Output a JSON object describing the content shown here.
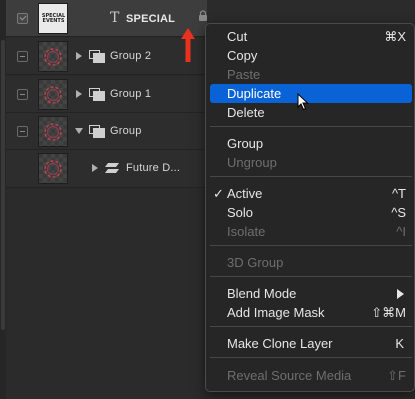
{
  "layers": [
    {
      "name": "SPECIAL",
      "kind": "text",
      "selected": true,
      "thumb_text": "SPECIAL EVENTS",
      "icon": "text-layer-icon",
      "lock": "lock-icon"
    },
    {
      "name": "Group 2",
      "kind": "group",
      "expanded": false,
      "icon": "group-icon"
    },
    {
      "name": "Group 1",
      "kind": "group",
      "expanded": false,
      "icon": "group-icon"
    },
    {
      "name": "Group",
      "kind": "group",
      "expanded": true,
      "icon": "group-icon"
    },
    {
      "name": "Future D...",
      "kind": "shape",
      "expanded": false,
      "icon": "shape-layer-icon"
    }
  ],
  "menu": {
    "items": [
      {
        "label": "Cut",
        "shortcut": "⌘X",
        "enabled": true
      },
      {
        "label": "Copy",
        "shortcut": "",
        "enabled": true
      },
      {
        "label": "Paste",
        "shortcut": "",
        "enabled": false
      },
      {
        "label": "Duplicate",
        "shortcut": "",
        "enabled": true,
        "highlighted": true
      },
      {
        "label": "Delete",
        "shortcut": "",
        "enabled": true
      },
      {
        "label": "Group",
        "shortcut": "",
        "enabled": true
      },
      {
        "label": "Ungroup",
        "shortcut": "",
        "enabled": false
      },
      {
        "label": "Active",
        "shortcut": "^T",
        "enabled": true,
        "checked": true
      },
      {
        "label": "Solo",
        "shortcut": "^S",
        "enabled": true
      },
      {
        "label": "Isolate",
        "shortcut": "^I",
        "enabled": false
      },
      {
        "label": "3D Group",
        "shortcut": "",
        "enabled": false
      },
      {
        "label": "Blend Mode",
        "shortcut": "",
        "enabled": true,
        "submenu": true
      },
      {
        "label": "Add Image Mask",
        "shortcut": "⇧⌘M",
        "enabled": true
      },
      {
        "label": "Make Clone Layer",
        "shortcut": "K",
        "enabled": true
      },
      {
        "label": "Reveal Source Media",
        "shortcut": "⇧F",
        "enabled": false
      }
    ]
  },
  "colors": {
    "highlight": "#0a63d6",
    "annotation_arrow": "#e8321e",
    "menu_bg": "#262626"
  }
}
